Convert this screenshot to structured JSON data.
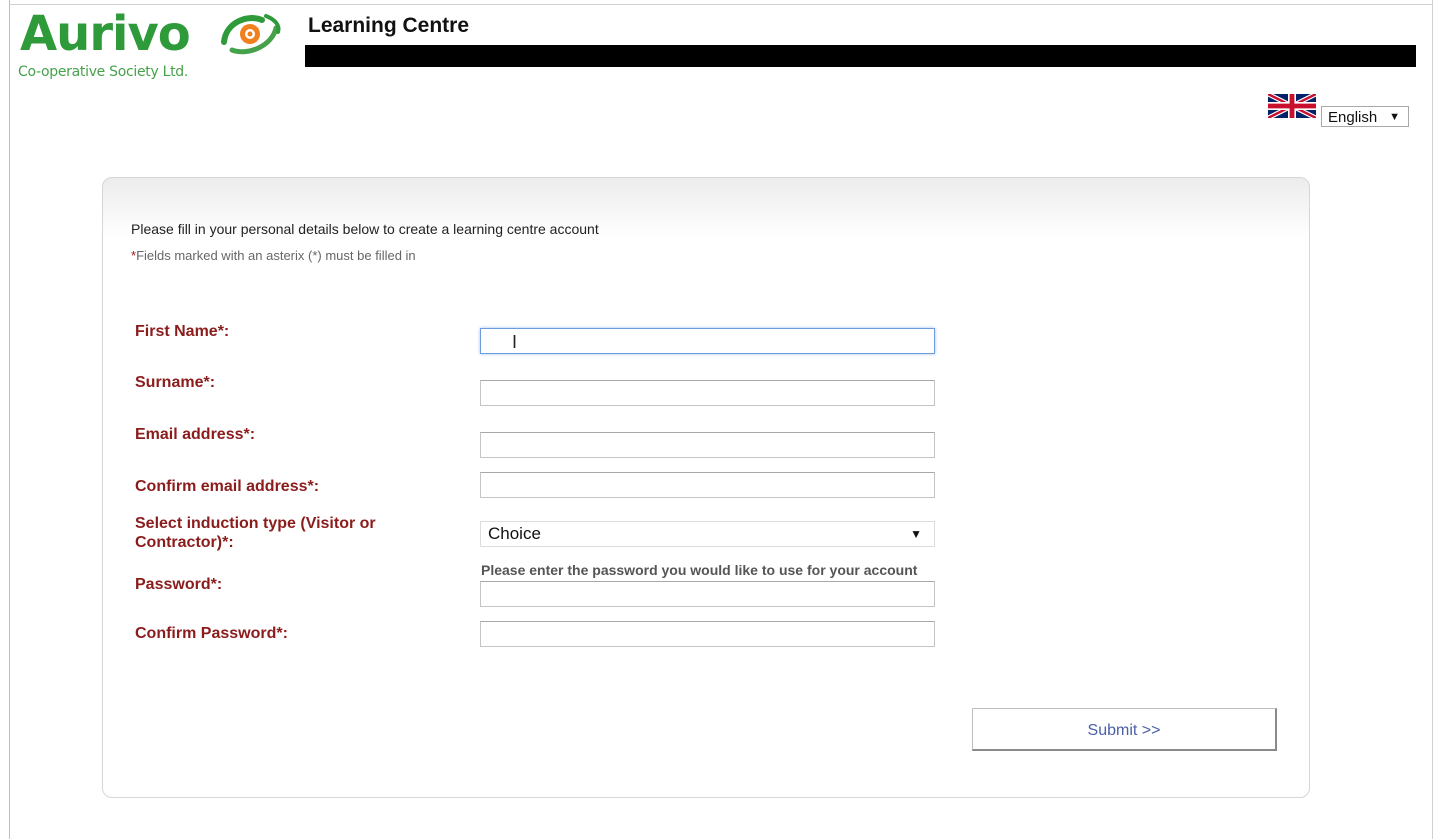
{
  "brand": {
    "name": "Aurivo",
    "tagline": "Co-operative Society Ltd.",
    "color": "#2f9a3a"
  },
  "header": {
    "title": "Learning Centre"
  },
  "language": {
    "selected": "English",
    "flag_icon": "uk-flag-icon"
  },
  "form": {
    "intro": "Please fill in your personal details below to create a learning centre account",
    "note_star": "*",
    "note_text": "Fields marked with an asterix (*) must be filled in",
    "labels": {
      "first_name": "First Name*:",
      "surname": "Surname*:",
      "email": "Email address*:",
      "confirm_email": "Confirm email address*:",
      "induction_line1": "Select induction type (Visitor or",
      "induction_line2": "Contractor)*:",
      "password": "Password*:",
      "confirm_password": "Confirm Password*:"
    },
    "values": {
      "first_name": "",
      "surname": "",
      "email": "",
      "confirm_email": "",
      "password": "",
      "confirm_password": ""
    },
    "induction_selected": "Choice",
    "password_hint": "Please enter the password you would like to use for your account",
    "submit_label": "Submit >>",
    "label_color": "#8b1c1c",
    "submit_color": "#4a5fa8"
  }
}
